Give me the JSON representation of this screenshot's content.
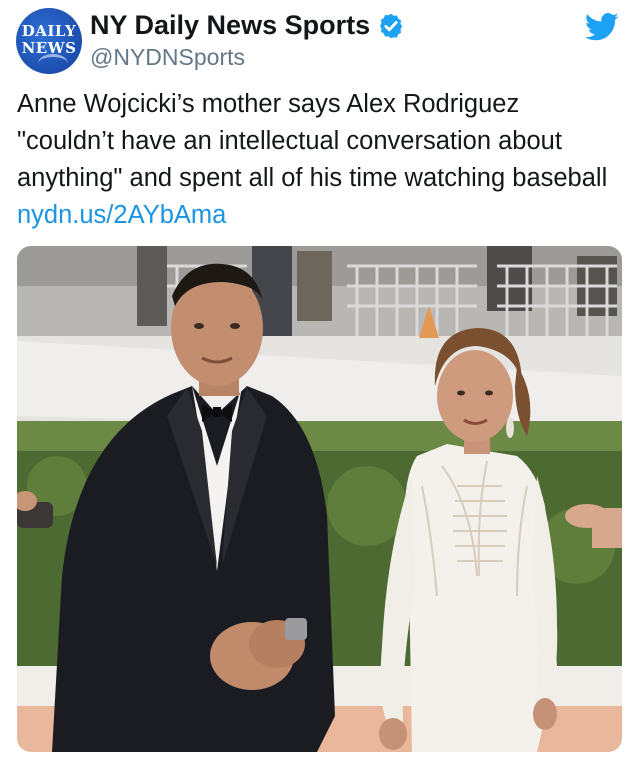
{
  "account": {
    "display_name": "NY Daily News Sports",
    "handle": "@NYDNSports",
    "avatar_logo_line1": "DAILY",
    "avatar_logo_line2": "NEWS",
    "verified": true
  },
  "tweet": {
    "text": "Anne Wojcicki’s mother says Alex Rodriguez \"couldn’t have an intellectual conversation about anything\" and spent all of his time watching baseball ",
    "link_text": "nydn.us/2AYbAma"
  },
  "icons": {
    "platform": "twitter-bird-icon",
    "badge": "verified-badge-icon"
  },
  "colors": {
    "link": "#1b95e0",
    "verified": "#1da1f2",
    "twitter": "#1da1f2",
    "handle": "#657786",
    "avatar": "#1c4fae"
  }
}
